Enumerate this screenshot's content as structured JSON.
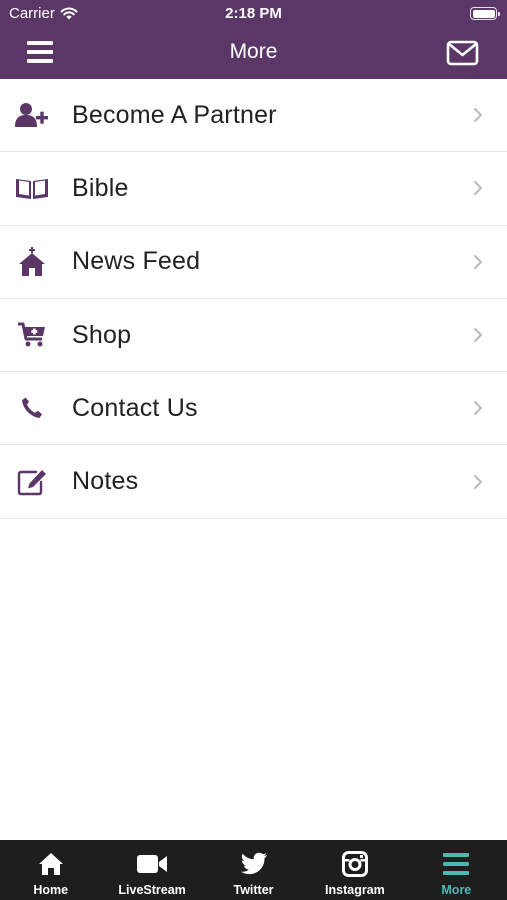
{
  "status_bar": {
    "carrier": "Carrier",
    "time": "2:18 PM"
  },
  "nav": {
    "title": "More"
  },
  "colors": {
    "accent": "#5b3768",
    "tab_bar": "#1e1e1e",
    "active_tab": "#4fb8b5"
  },
  "menu_items": [
    {
      "label": "Become A Partner",
      "icon": "add-user-icon"
    },
    {
      "label": "Bible",
      "icon": "open-book-icon"
    },
    {
      "label": "News Feed",
      "icon": "church-icon"
    },
    {
      "label": "Shop",
      "icon": "cart-icon"
    },
    {
      "label": "Contact Us",
      "icon": "phone-icon"
    },
    {
      "label": "Notes",
      "icon": "edit-note-icon"
    }
  ],
  "tabs": [
    {
      "label": "Home",
      "icon": "home-icon"
    },
    {
      "label": "LiveStream",
      "icon": "video-camera-icon"
    },
    {
      "label": "Twitter",
      "icon": "twitter-icon"
    },
    {
      "label": "Instagram",
      "icon": "instagram-icon"
    },
    {
      "label": "More",
      "icon": "menu-icon",
      "active": true
    }
  ]
}
